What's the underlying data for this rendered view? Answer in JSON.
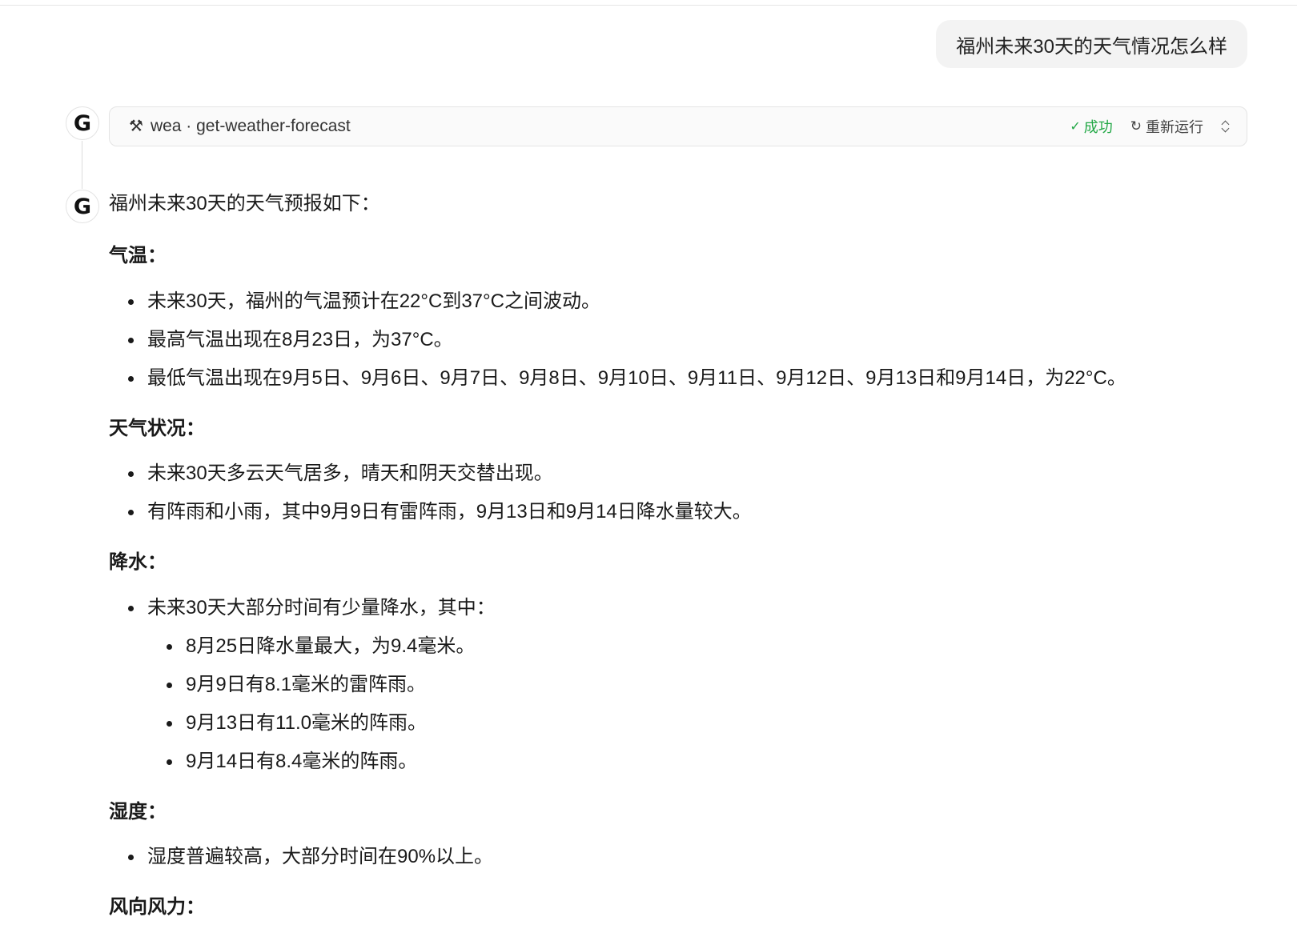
{
  "user_message": "福州未来30天的天气情况怎么样",
  "assistant_avatar_letter": "G",
  "tool_call": {
    "icon": "hammer-icon",
    "name": "wea · get-weather-forecast",
    "status": "成功",
    "status_color": "#22a846",
    "rerun_label": "重新运行"
  },
  "answer": {
    "intro": "福州未来30天的天气预报如下：",
    "sections": [
      {
        "title": "气温：",
        "items": [
          "未来30天，福州的气温预计在22°C到37°C之间波动。",
          "最高气温出现在8月23日，为37°C。",
          "最低气温出现在9月5日、9月6日、9月7日、9月8日、9月10日、9月11日、9月12日、9月13日和9月14日，为22°C。"
        ]
      },
      {
        "title": "天气状况：",
        "items": [
          "未来30天多云天气居多，晴天和阴天交替出现。",
          "有阵雨和小雨，其中9月9日有雷阵雨，9月13日和9月14日降水量较大。"
        ]
      },
      {
        "title": "降水：",
        "items": [
          "未来30天大部分时间有少量降水，其中："
        ],
        "subitems": [
          "8月25日降水量最大，为9.4毫米。",
          "9月9日有8.1毫米的雷阵雨。",
          "9月13日有11.0毫米的阵雨。",
          "9月14日有8.4毫米的阵雨。"
        ]
      },
      {
        "title": "湿度：",
        "items": [
          "湿度普遍较高，大部分时间在90%以上。"
        ]
      },
      {
        "title": "风向风力："
      }
    ]
  }
}
